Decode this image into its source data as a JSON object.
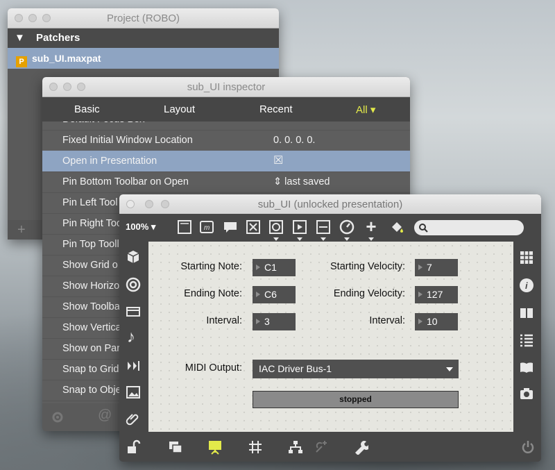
{
  "project_window": {
    "title": "Project (ROBO)",
    "section_label": "Patchers",
    "file_badge": "P",
    "file_name": "sub_UI.maxpat",
    "add_glyph": "+"
  },
  "inspector": {
    "title": "sub_UI inspector",
    "tabs": [
      {
        "label": "Basic"
      },
      {
        "label": "Layout"
      },
      {
        "label": "Recent"
      },
      {
        "label": "All ▾"
      }
    ],
    "accent_color": "#e3ea4a",
    "rows": [
      {
        "label": "Default Focus Box",
        "value": ""
      },
      {
        "label": "Fixed Initial Window Location",
        "value": "0. 0. 0. 0."
      },
      {
        "label": "Open in Presentation",
        "value": "☒"
      },
      {
        "label": "Pin Bottom Toolbar on Open",
        "value": "⇕ last saved"
      },
      {
        "label": "Pin Left Tool",
        "value": ""
      },
      {
        "label": "Pin Right Too",
        "value": ""
      },
      {
        "label": "Pin Top Tooll",
        "value": ""
      },
      {
        "label": "Show Grid o",
        "value": ""
      },
      {
        "label": "Show Horizo",
        "value": ""
      },
      {
        "label": "Show Toolba",
        "value": ""
      },
      {
        "label": "Show Vertica",
        "value": ""
      },
      {
        "label": "Show on Par",
        "value": ""
      },
      {
        "label": "Snap to Grid",
        "value": ""
      },
      {
        "label": "Snap to Obje",
        "value": ""
      }
    ]
  },
  "patcher": {
    "title": "sub_UI (unlocked presentation)",
    "zoom": "100%",
    "labels": {
      "starting_note": "Starting Note:",
      "ending_note": "Ending Note:",
      "interval_left": "Interval:",
      "starting_velocity": "Starting Velocity:",
      "ending_velocity": "Ending Velocity:",
      "interval_right": "Interval:",
      "midi_output": "MIDI Output:"
    },
    "values": {
      "starting_note": "C1",
      "ending_note": "C6",
      "interval_left": "3",
      "starting_velocity": "7",
      "ending_velocity": "127",
      "interval_right": "10"
    },
    "midi_output_selected": "IAC Driver Bus-1",
    "status_message": "stopped"
  }
}
